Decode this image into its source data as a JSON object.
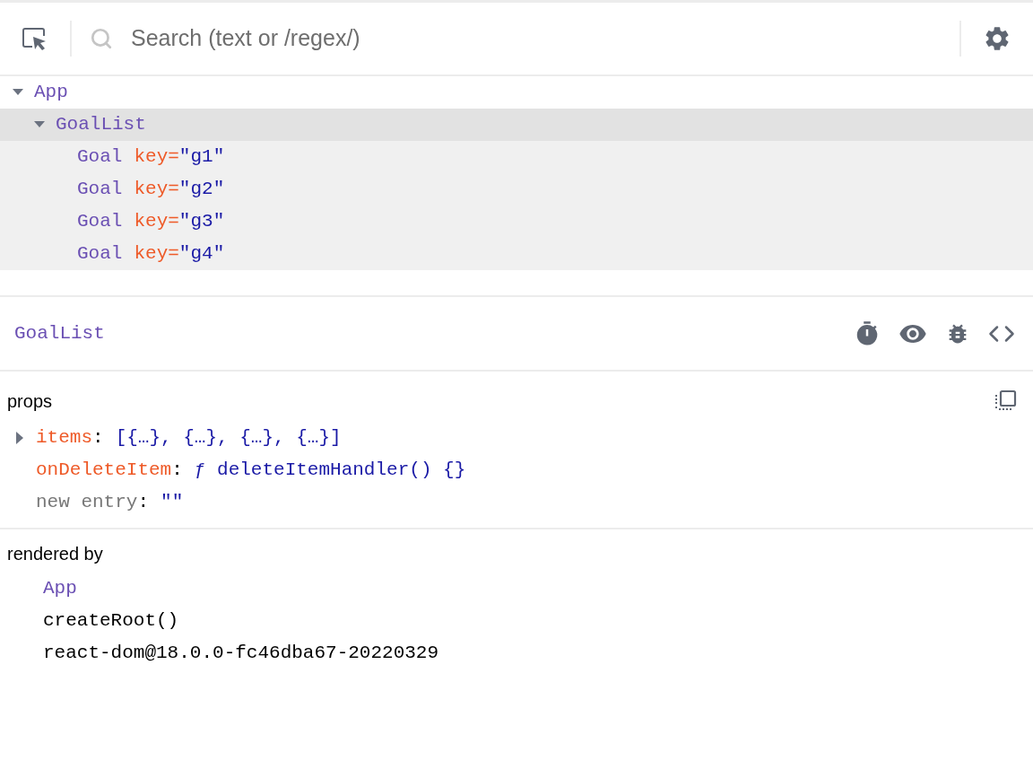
{
  "toolbar": {
    "search": {
      "placeholder": "Search (text or /regex/)"
    }
  },
  "tree": [
    {
      "name": "App",
      "expanded": true,
      "selected": false,
      "children": [
        {
          "name": "GoalList",
          "expanded": true,
          "selected": true,
          "children": [
            {
              "name": "Goal",
              "attr": "key=",
              "attr_value": "\"g1\"",
              "selected": false
            },
            {
              "name": "Goal",
              "attr": "key=",
              "attr_value": "\"g2\"",
              "selected": false
            },
            {
              "name": "Goal",
              "attr": "key=",
              "attr_value": "\"g3\"",
              "selected": false
            },
            {
              "name": "Goal",
              "attr": "key=",
              "attr_value": "\"g4\"",
              "selected": false
            }
          ]
        }
      ]
    }
  ],
  "inspector": {
    "title": "GoalList",
    "props": {
      "heading": "props",
      "separator": ":",
      "items": [
        {
          "name": "items",
          "value": "[{…}, {…}, {…}, {…}]",
          "kind": "collapsible"
        },
        {
          "name": "onDeleteItem",
          "value": "ƒ deleteItemHandler() {}",
          "kind": "plain"
        },
        {
          "name": "new entry",
          "value": "\"\"",
          "kind": "new"
        }
      ]
    },
    "rendered_by": {
      "heading": "rendered by",
      "items": [
        {
          "text": "App",
          "kind": "component"
        },
        {
          "text": "createRoot()",
          "kind": "plain"
        },
        {
          "text": "react-dom@18.0.0-fc46dba67-20220329",
          "kind": "plain"
        }
      ]
    }
  }
}
